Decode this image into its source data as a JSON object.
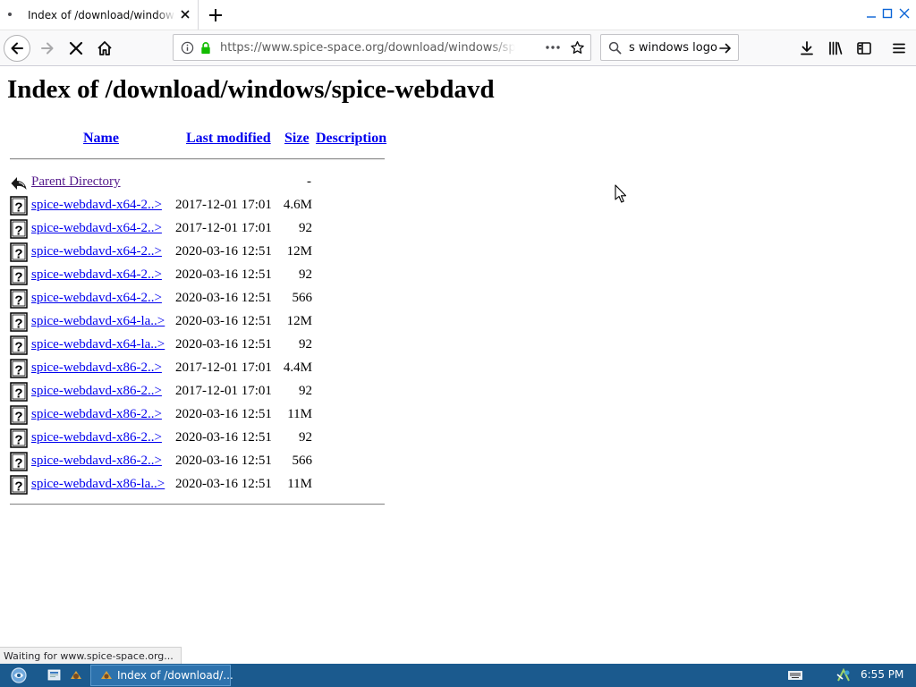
{
  "browser": {
    "tab_title": "Index of /download/windows/spice-webdavd",
    "url": "https://www.spice-space.org/download/windows/spice-webdavd/",
    "search_value": "s windows logo",
    "status_text": "Waiting for www.spice-space.org..."
  },
  "page": {
    "heading": "Index of /download/windows/spice-webdavd",
    "columns": {
      "name": "Name",
      "last_modified": "Last modified",
      "size": "Size",
      "description": "Description"
    },
    "parent": {
      "label": "Parent Directory",
      "size": "-"
    },
    "rows": [
      {
        "name": "spice-webdavd-x64-2..>",
        "date": "2017-12-01 17:01",
        "size": "4.6M"
      },
      {
        "name": "spice-webdavd-x64-2..>",
        "date": "2017-12-01 17:01",
        "size": "92"
      },
      {
        "name": "spice-webdavd-x64-2..>",
        "date": "2020-03-16 12:51",
        "size": "12M"
      },
      {
        "name": "spice-webdavd-x64-2..>",
        "date": "2020-03-16 12:51",
        "size": "92"
      },
      {
        "name": "spice-webdavd-x64-2..>",
        "date": "2020-03-16 12:51",
        "size": "566"
      },
      {
        "name": "spice-webdavd-x64-la..>",
        "date": "2020-03-16 12:51",
        "size": "12M"
      },
      {
        "name": "spice-webdavd-x64-la..>",
        "date": "2020-03-16 12:51",
        "size": "92"
      },
      {
        "name": "spice-webdavd-x86-2..>",
        "date": "2017-12-01 17:01",
        "size": "4.4M"
      },
      {
        "name": "spice-webdavd-x86-2..>",
        "date": "2017-12-01 17:01",
        "size": "92"
      },
      {
        "name": "spice-webdavd-x86-2..>",
        "date": "2020-03-16 12:51",
        "size": "11M"
      },
      {
        "name": "spice-webdavd-x86-2..>",
        "date": "2020-03-16 12:51",
        "size": "92"
      },
      {
        "name": "spice-webdavd-x86-2..>",
        "date": "2020-03-16 12:51",
        "size": "566"
      },
      {
        "name": "spice-webdavd-x86-la..>",
        "date": "2020-03-16 12:51",
        "size": "11M"
      }
    ]
  },
  "taskbar": {
    "task_label": "Index of /download/...",
    "clock": "6:55 PM"
  },
  "colors": {
    "link": "#0000ee",
    "visited_link": "#551a8b",
    "taskbar": "#1b5a8e",
    "secure_lock": "#12bc00"
  },
  "icons": {
    "file_row": "unknown-file-icon",
    "parent": "back-arrow-icon"
  }
}
